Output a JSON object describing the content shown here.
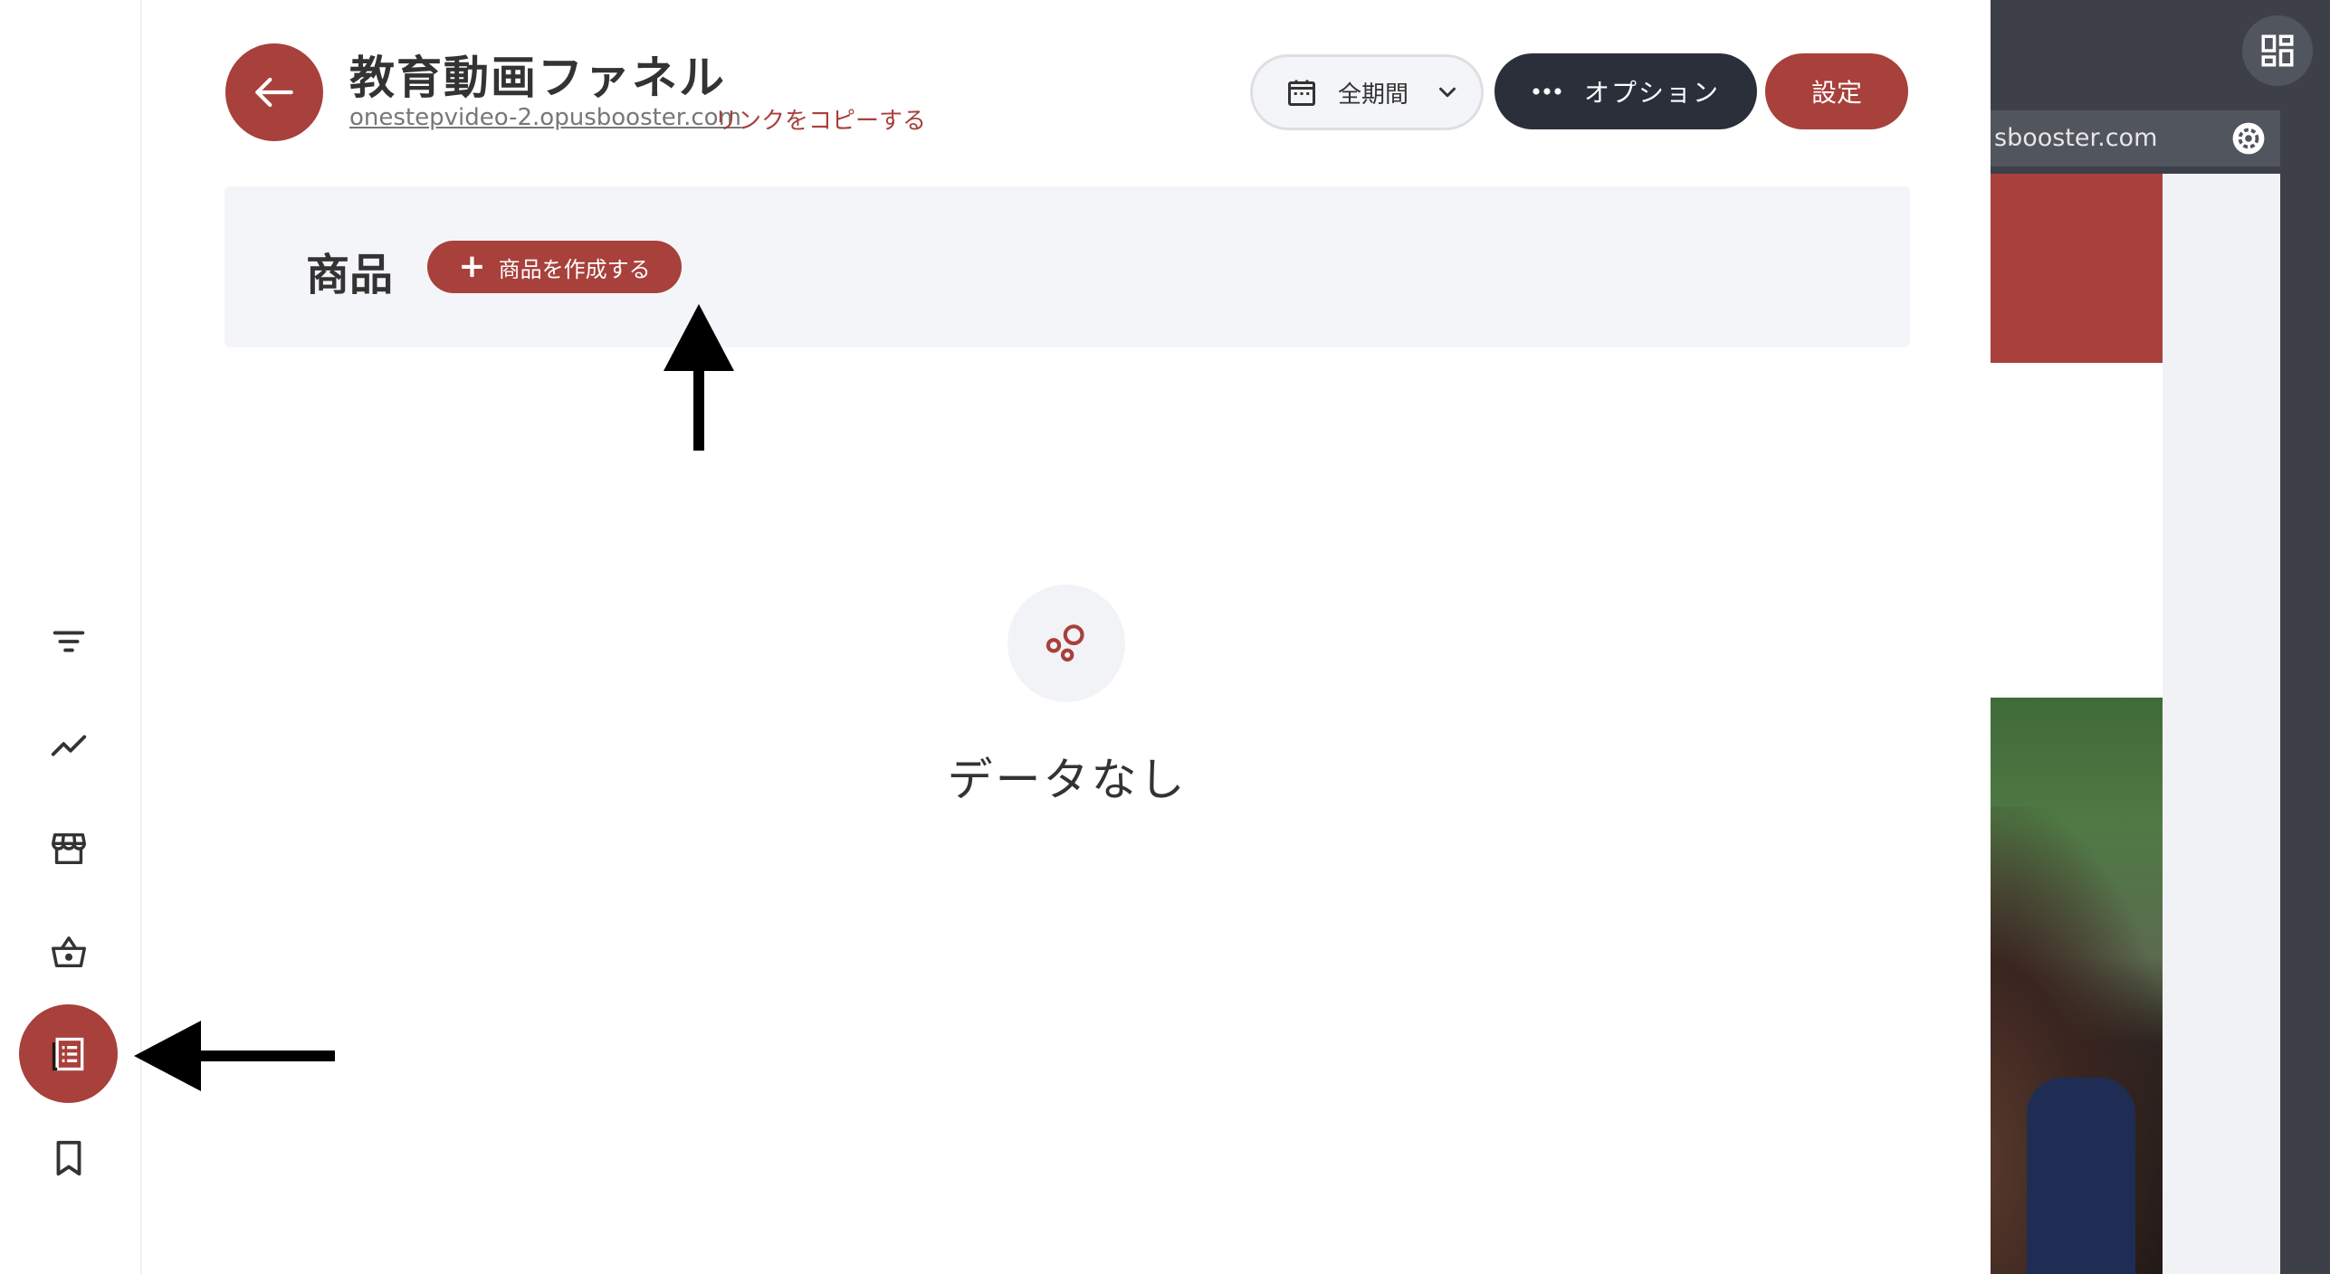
{
  "header": {
    "title": "教育動画ファネル",
    "url": "onestepvideo-2.opusbooster.com",
    "copy_link_label": "リンクをコピーする",
    "period_label": "全期間",
    "options_label": "オプション",
    "settings_label": "設定"
  },
  "products": {
    "heading": "商品",
    "create_button_label": "商品を作成する"
  },
  "empty_state": {
    "text": "データなし"
  },
  "sidebar": {
    "items": [
      {
        "icon": "filter-icon",
        "active": false
      },
      {
        "icon": "trend-line-icon",
        "active": false
      },
      {
        "icon": "storefront-icon",
        "active": false
      },
      {
        "icon": "basket-icon",
        "active": false
      },
      {
        "icon": "list-document-icon",
        "active": true
      },
      {
        "icon": "bookmark-icon",
        "active": false
      }
    ]
  },
  "background_window": {
    "address_fragment": "sbooster.com"
  },
  "colors": {
    "accent": "#a8403b",
    "dark_button": "#2b2f3a",
    "panel_bg": "#f4f5f8",
    "text": "#333333"
  }
}
